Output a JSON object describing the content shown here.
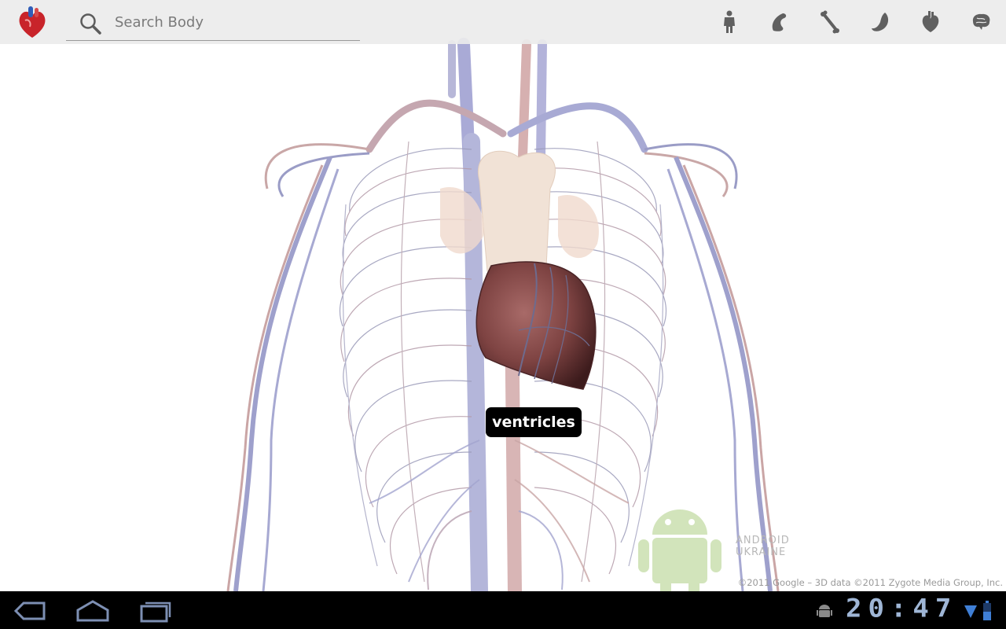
{
  "app": {
    "logo_icon": "heart-logo-icon"
  },
  "search": {
    "placeholder": "Search Body",
    "icon": "search-icon"
  },
  "layers": [
    {
      "name": "skin-layer",
      "icon": "human-figure-icon"
    },
    {
      "name": "muscle-layer",
      "icon": "muscle-icon"
    },
    {
      "name": "skeleton-layer",
      "icon": "bone-icon"
    },
    {
      "name": "organ-layer",
      "icon": "stomach-icon"
    },
    {
      "name": "circulatory-layer",
      "icon": "heart-icon"
    },
    {
      "name": "nervous-layer",
      "icon": "brain-icon"
    }
  ],
  "viewer": {
    "selected_label": "ventricles",
    "watermark_lines": [
      "ANDROID",
      "UKRAINE"
    ],
    "copyright": "©2011 Google – 3D data ©2011 Zygote Media Group, Inc."
  },
  "system_bar": {
    "clock": "20:47",
    "buttons": [
      "back",
      "home",
      "recent-apps"
    ],
    "icons": [
      "android-debug-icon",
      "wifi-icon",
      "battery-icon"
    ]
  },
  "colors": {
    "toolbar_bg": "#ececec",
    "label_bg": "#000000",
    "clock": "#9fb6d6",
    "vein": "#8c8fc4",
    "artery": "#c9a0a0"
  }
}
